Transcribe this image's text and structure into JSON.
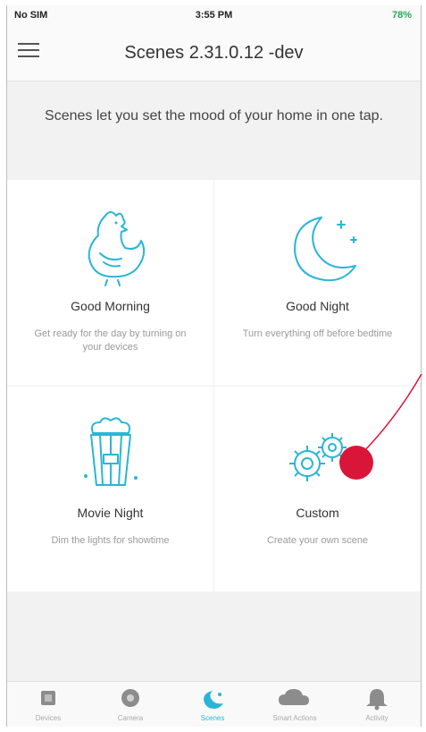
{
  "status_bar": {
    "carrier": "No SIM",
    "time": "3:55 PM",
    "battery": "78%"
  },
  "header": {
    "title": "Scenes 2.31.0.12 -dev"
  },
  "intro_text": "Scenes let you set the mood of your home in one tap.",
  "scenes": [
    {
      "name": "Good Morning",
      "description": "Get ready for the day by turning on your devices",
      "icon": "rooster-icon"
    },
    {
      "name": "Good Night",
      "description": "Turn everything off before bedtime",
      "icon": "moon-icon"
    },
    {
      "name": "Movie Night",
      "description": "Dim the lights for showtime",
      "icon": "popcorn-icon"
    },
    {
      "name": "Custom",
      "description": "Create your own scene",
      "icon": "gears-icon"
    }
  ],
  "tabs": [
    {
      "label": "Devices",
      "icon": "devices-icon"
    },
    {
      "label": "Camera",
      "icon": "camera-icon"
    },
    {
      "label": "Scenes",
      "icon": "scenes-icon",
      "active": true
    },
    {
      "label": "Smart Actions",
      "icon": "cloud-icon"
    },
    {
      "label": "Activity",
      "icon": "bell-icon"
    }
  ],
  "colors": {
    "accent": "#29b6d6",
    "marker": "#d9163a"
  }
}
